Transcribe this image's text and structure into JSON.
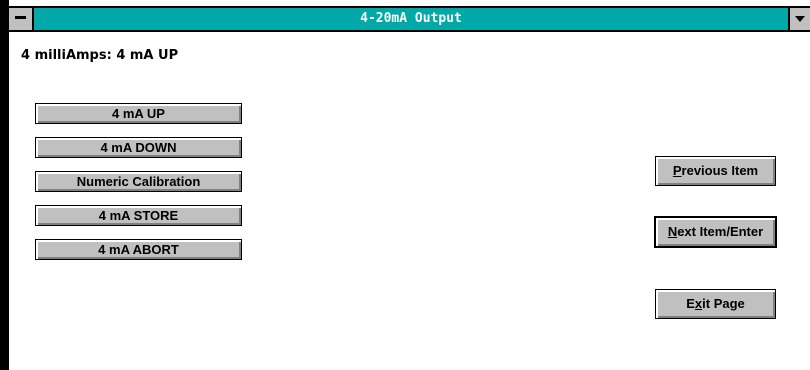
{
  "window": {
    "title": "4-20mA Output"
  },
  "status": {
    "text": "4 milliAmps: 4 mA UP"
  },
  "left_buttons": [
    {
      "label": "4 mA UP"
    },
    {
      "label": "4 mA DOWN"
    },
    {
      "label": "Numeric Calibration"
    },
    {
      "label": "4 mA STORE"
    },
    {
      "label": "4 mA ABORT"
    }
  ],
  "right_buttons": {
    "previous": {
      "mnemonic": "P",
      "rest": "revious Item"
    },
    "next": {
      "mnemonic": "N",
      "rest": "ext Item/Enter"
    },
    "exit": {
      "pre": "E",
      "mnemonic": "x",
      "rest": "it Page"
    }
  },
  "colors": {
    "titlebar": "#00a8a8",
    "button_face": "#c0c0c0",
    "background": "#ffffff"
  },
  "icons": {
    "system_menu": "system-menu-icon",
    "minimize": "minimize-icon"
  }
}
